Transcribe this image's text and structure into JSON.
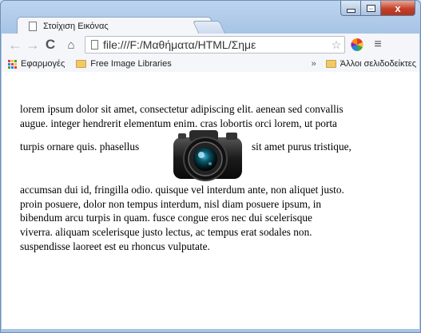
{
  "window": {
    "caption_buttons": [
      "minimize",
      "maximize",
      "close"
    ],
    "close_glyph": "x"
  },
  "tab": {
    "title": "Στοίχιση Εικόνας",
    "close": "×"
  },
  "toolbar": {
    "back": "←",
    "forward": "→",
    "reload": "C",
    "home": "⌂",
    "url": "file:///F:/Μαθήματα/HTML/Σημε",
    "star": "☆",
    "menu": "≡"
  },
  "bookmarks": {
    "apps_label": "Εφαρμογές",
    "items": [
      "Free Image Libraries"
    ],
    "more": "»",
    "other_label": "Άλλοι σελιδοδείκτες"
  },
  "page": {
    "lines_before": [
      "lorem ipsum dolor sit amet, consectetur adipiscing elit. aenean sed convallis",
      "augue. integer hendrerit elementum enim. cras lobortis orci lorem, ut porta"
    ],
    "inline_before": "turpis ornare quis. phasellus",
    "inline_after": "sit amet purus tristique,",
    "lines_after": [
      "accumsan dui id, fringilla odio. quisque vel interdum ante, non aliquet justo.",
      "proin posuere, dolor non tempus interdum, nisl diam posuere ipsum, in",
      "bibendum arcu turpis in quam. fusce congue eros nec dui scelerisque",
      "viverra. aliquam scelerisque justo lectus, ac tempus erat sodales non.",
      "suspendisse laoreet est eu rhoncus vulputate."
    ],
    "image": "camera-image"
  },
  "colors": {
    "frame": "#a7c4e6",
    "close_button": "#c5402a",
    "toolbar": "#f4f6f9",
    "folder": "#f2c969"
  }
}
